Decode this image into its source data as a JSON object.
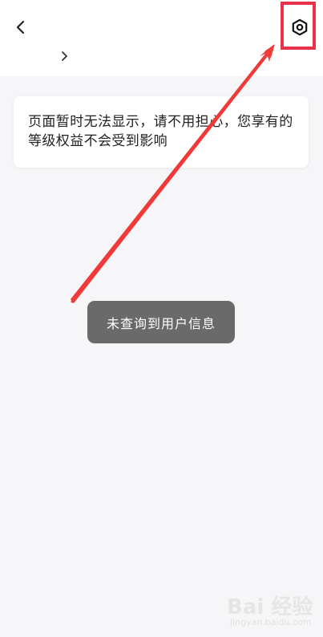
{
  "header": {
    "back_icon": "chevron-left-icon",
    "subtitle_chevron_icon": "chevron-right-icon",
    "settings_icon": "hexagon-settings-icon"
  },
  "notice": {
    "text": "页面暂时无法显示，请不用担心，您享有的等级权益不会受到影响"
  },
  "toast": {
    "text": "未查询到用户信息"
  },
  "annotation": {
    "highlight_color": "#e8324a",
    "arrow_color": "#f03a3a"
  },
  "watermark": {
    "main": "Bai 经验",
    "sub": "jingyan.baidu.com"
  }
}
